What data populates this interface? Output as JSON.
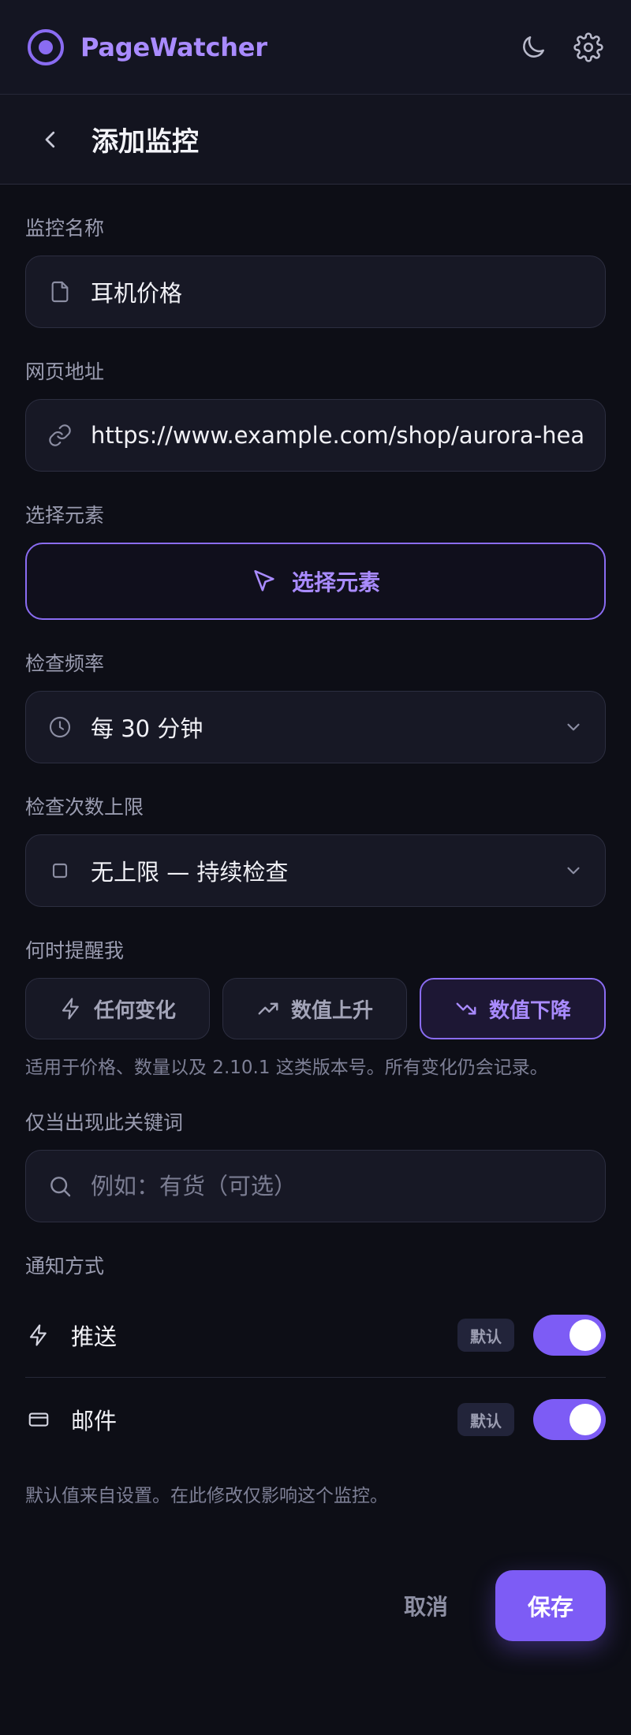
{
  "app": {
    "brand": "PageWatcher"
  },
  "page": {
    "title": "添加监控"
  },
  "form": {
    "name": {
      "label": "监控名称",
      "value": "耳机价格"
    },
    "url": {
      "label": "网页地址",
      "value": "https://www.example.com/shop/aurora-headphones"
    },
    "element": {
      "label": "选择元素",
      "button_label": "选择元素"
    },
    "frequency": {
      "label": "检查频率",
      "value": "每 30 分钟"
    },
    "limit": {
      "label": "检查次数上限",
      "value": "无上限 — 持续检查"
    },
    "alert": {
      "label": "何时提醒我",
      "options": [
        {
          "label": "任何变化",
          "icon": "bolt-icon"
        },
        {
          "label": "数值上升",
          "icon": "trend-up-icon"
        },
        {
          "label": "数值下降",
          "icon": "trend-down-icon"
        }
      ],
      "selected": "数值下降",
      "hint": "适用于价格、数量以及 2.10.1 这类版本号。所有变化仍会记录。"
    },
    "keyword": {
      "label": "仅当出现此关键词",
      "placeholder": "例如：有货（可选）"
    },
    "notify": {
      "label": "通知方式",
      "channels": [
        {
          "label": "推送",
          "badge": "默认",
          "enabled": true,
          "icon": "bolt-icon"
        },
        {
          "label": "邮件",
          "badge": "默认",
          "enabled": true,
          "icon": "card-icon"
        }
      ],
      "hint": "默认值来自设置。在此修改仅影响这个监控。"
    }
  },
  "actions": {
    "cancel": "取消",
    "save": "保存"
  },
  "colors": {
    "accent": "#7d5cf5",
    "accent_text": "#a98bff",
    "background": "#0d0e16"
  }
}
